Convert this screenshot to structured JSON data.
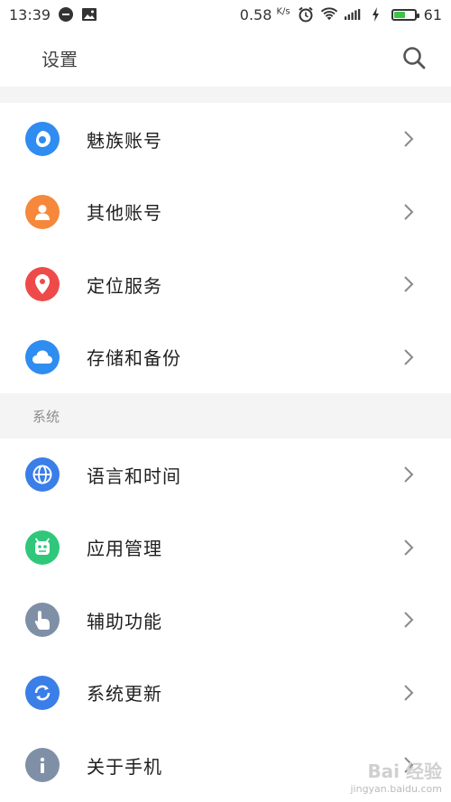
{
  "status_bar": {
    "time": "13:39",
    "network_speed": "0.58",
    "speed_unit": "K/s",
    "battery_level": "61",
    "battery_fraction": 0.61,
    "icons": [
      "notification-icon",
      "image-icon",
      "alarm-icon",
      "wifi-icon",
      "signal-4g-icon",
      "charging-icon",
      "battery-icon"
    ]
  },
  "app_bar": {
    "title": "设置",
    "search_icon": "search-icon"
  },
  "accounts_group": {
    "items": [
      {
        "label": "魅族账号",
        "icon": "meizu-account-icon",
        "color": "#2f8cf0"
      },
      {
        "label": "其他账号",
        "icon": "person-icon",
        "color": "#f5883a"
      },
      {
        "label": "定位服务",
        "icon": "location-pin-icon",
        "color": "#ee4a4a"
      },
      {
        "label": "存储和备份",
        "icon": "cloud-icon",
        "color": "#2f8cf0"
      }
    ]
  },
  "system_group": {
    "header": "系统",
    "items": [
      {
        "label": "语言和时间",
        "icon": "globe-icon",
        "color": "#3a7ee8"
      },
      {
        "label": "应用管理",
        "icon": "android-icon",
        "color": "#2fc77a"
      },
      {
        "label": "辅助功能",
        "icon": "hand-pointer-icon",
        "color": "#7f8fa6"
      },
      {
        "label": "系统更新",
        "icon": "refresh-icon",
        "color": "#3a7ee8"
      },
      {
        "label": "关于手机",
        "icon": "info-icon",
        "color": "#7f8fa6"
      }
    ]
  },
  "watermark": {
    "main": "Bai 经验",
    "sub": "jingyan.baidu.com"
  }
}
